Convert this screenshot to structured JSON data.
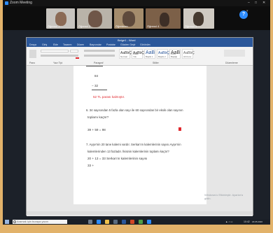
{
  "zoom": {
    "title": "Zoom Meeting",
    "controls": [
      "–",
      "□",
      "✕"
    ],
    "participants": [
      {
        "name": "Öğrenci 1"
      },
      {
        "name": "Öğrenci 2"
      },
      {
        "name": "Öğretmen"
      },
      {
        "name": "Öğrenci 4"
      },
      {
        "name": "Öğrenci 5"
      }
    ]
  },
  "word": {
    "title": "Belge1 - Word",
    "tabs": [
      "Dosya",
      "Giriş",
      "Ekle",
      "Tasarım",
      "Düzen",
      "Başvurular",
      "Postalar",
      "Gözden Geçir",
      "Görünüm"
    ],
    "styles": [
      {
        "sample": "AaBbÇ",
        "label": "Normal"
      },
      {
        "sample": "AaBbÇ",
        "label": "Aralık Yok"
      },
      {
        "sample": "AaB",
        "label": "Başlık 1"
      },
      {
        "sample": "AaBbÇ",
        "label": "Başlık 2"
      },
      {
        "sample": "AaB",
        "label": "Konu Başlığı"
      },
      {
        "sample": "AaBbÇ",
        "label": "Alt Konu"
      }
    ],
    "ribbon_groups": [
      "Pano",
      "Yazı Tipi",
      "Paragraf",
      "Stiller",
      "Düzenleme"
    ]
  },
  "document": {
    "lines": [
      {
        "text": "84",
        "style": "normal"
      },
      {
        "text": "− 32",
        "style": "normal"
      },
      {
        "text": "52 TL parası kalmıştır.",
        "style": "red"
      },
      {
        "text": "6. 34 sayısından 5 fazla olan sayı ile 60 sayısından bir eksik olan sayının",
        "style": "normal"
      },
      {
        "text": "toplamı kaçtır?",
        "style": "normal"
      },
      {
        "text": "39 + 59 = 98",
        "style": "normal"
      },
      {
        "text": "7. Ayşe'nin 20 tane kalemi vardır. Serkan'ın kalemlerinin sayısı Ayşe'nin",
        "style": "normal"
      },
      {
        "text": "kalemlerinden 13 fazladır. İkisinin kalemlerinin toplamı kaçtır?",
        "style": "normal"
      },
      {
        "text": "20 + 13 = 33 Serkan'ın kalemlerinin sayısı",
        "style": "normal"
      },
      {
        "text": "33 +",
        "style": "normal"
      }
    ]
  },
  "watermark": "Windows'u Etkinleştir. Ayarlar'a gidin.",
  "taskbar": {
    "search_placeholder": "Aramak için buraya yazın",
    "time": "10:42",
    "date": "18.05.2020"
  },
  "colors": {
    "word_blue": "#2b579a",
    "zoom_blue": "#2d8cff",
    "answer_red": "#e0282e"
  }
}
